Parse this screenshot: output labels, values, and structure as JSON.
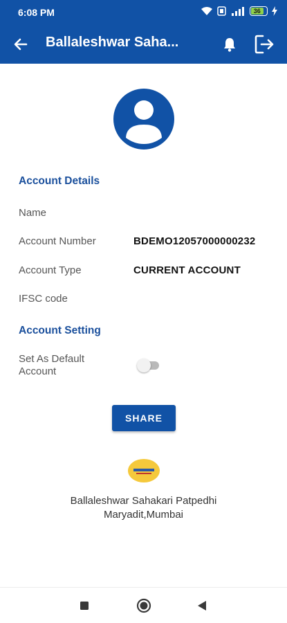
{
  "status_bar": {
    "time": "6:08 PM",
    "battery_level": "36"
  },
  "app_bar": {
    "title": "Ballaleshwar Saha..."
  },
  "account_details": {
    "section_title": "Account Details",
    "fields": [
      {
        "label": "Name",
        "value": ""
      },
      {
        "label": "Account Number",
        "value": "BDEMO12057000000232"
      },
      {
        "label": "Account Type",
        "value": "CURRENT ACCOUNT"
      },
      {
        "label": "IFSC code",
        "value": ""
      }
    ]
  },
  "account_setting": {
    "section_title": "Account Setting",
    "default_label": "Set As Default Account",
    "default_enabled": false
  },
  "share_button_label": "SHARE",
  "footer": {
    "bank_name_line1": "Ballaleshwar Sahakari Patpedhi",
    "bank_name_line2": "Maryadit,Mumbai"
  },
  "colors": {
    "primary": "#1152a6",
    "section_title": "#1a4f9c",
    "logo_yellow": "#f5c93c"
  }
}
